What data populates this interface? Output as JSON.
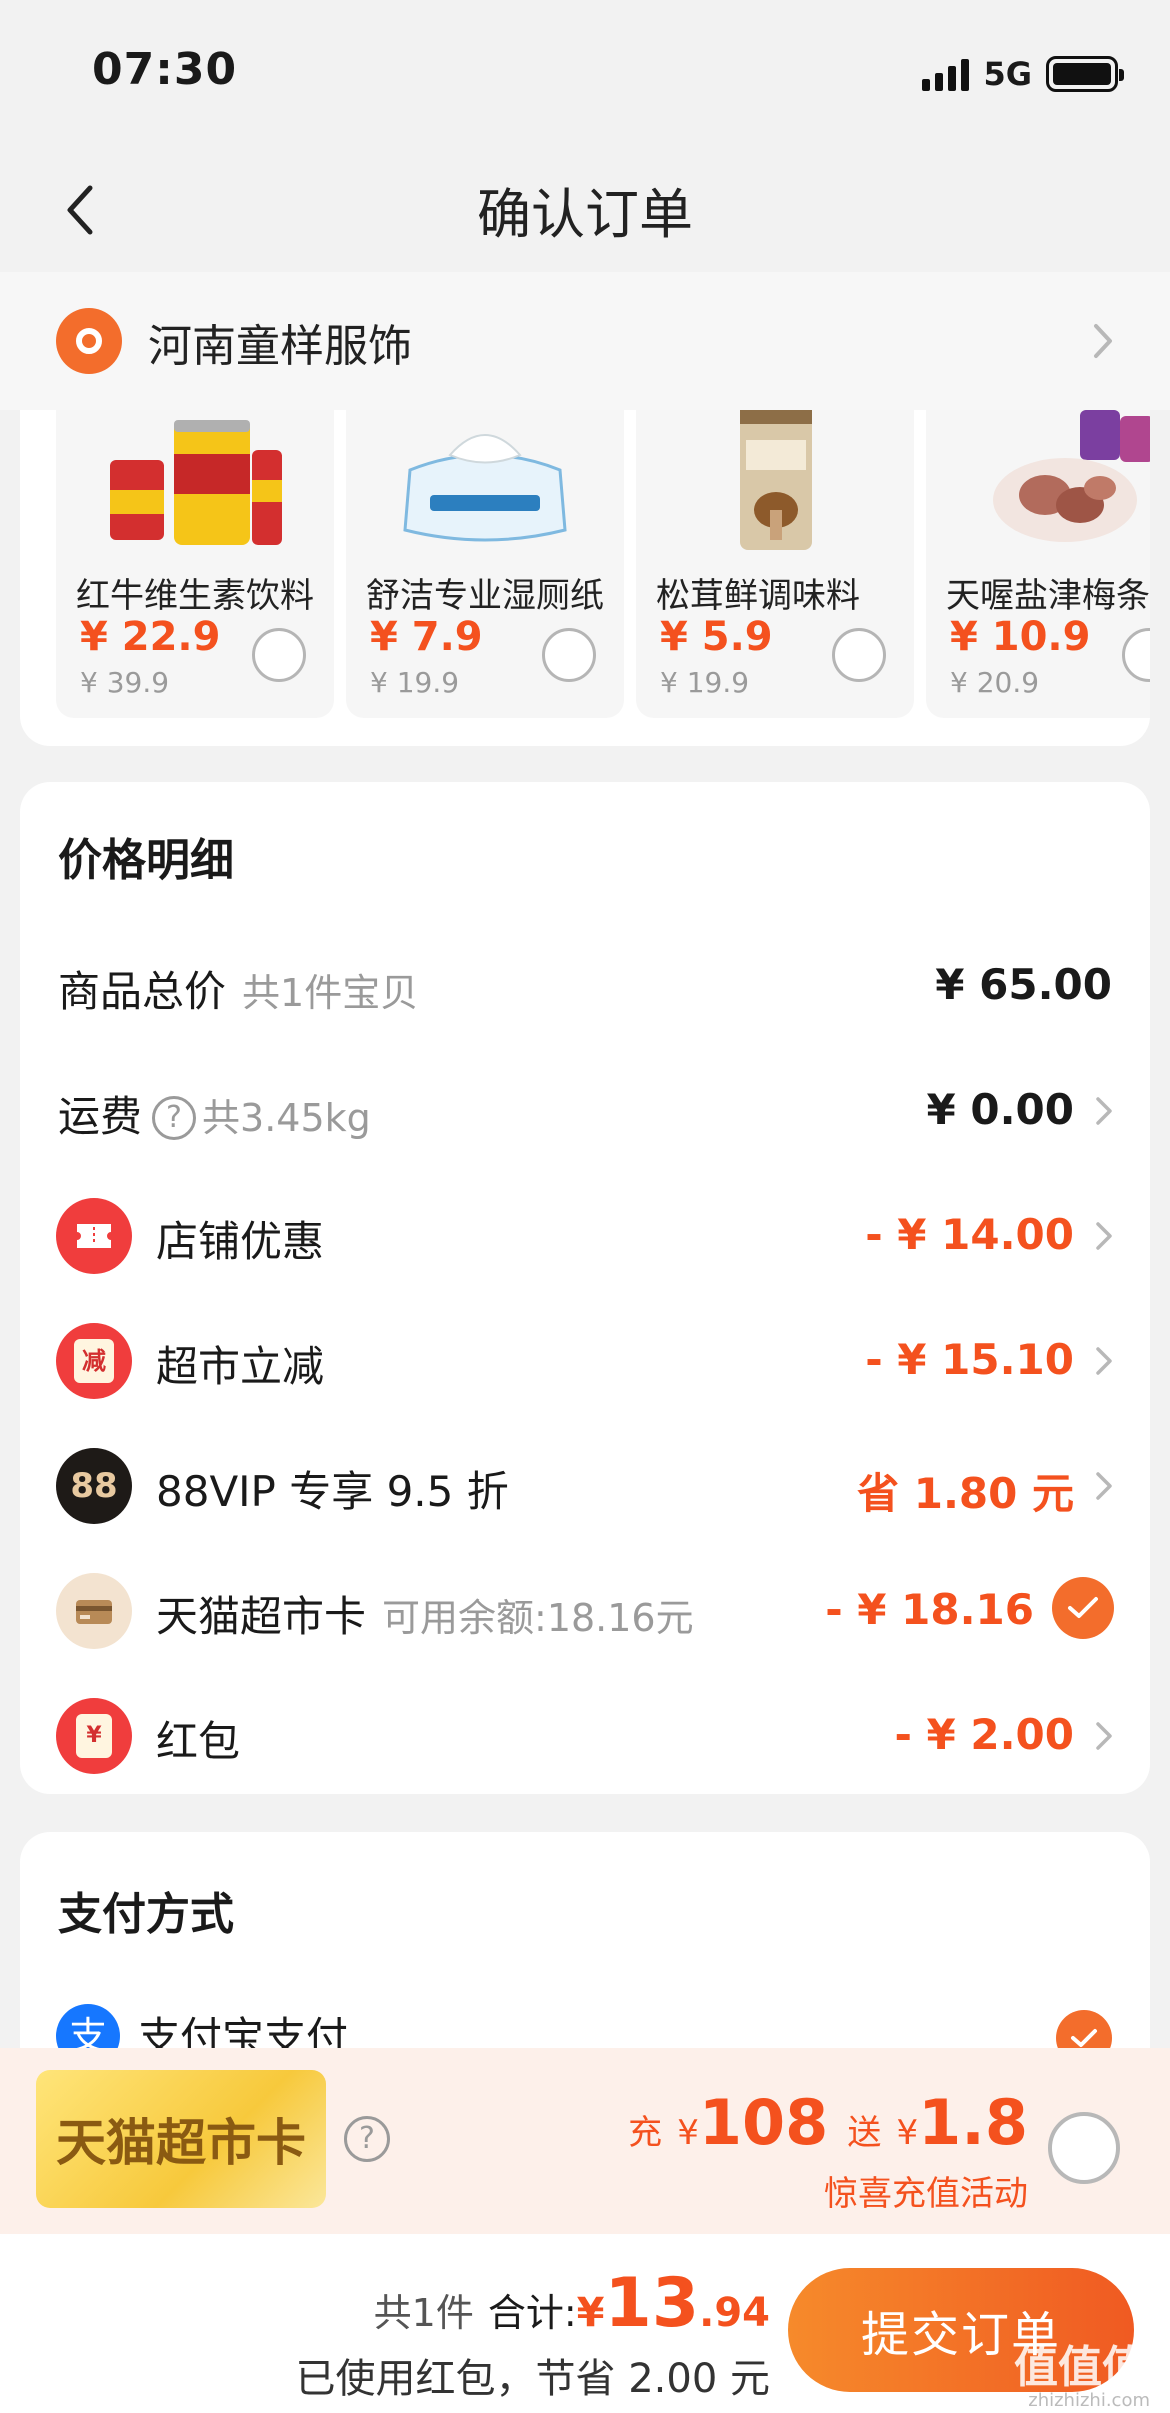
{
  "status_bar": {
    "time": "07:30",
    "network": "5G"
  },
  "nav": {
    "title": "确认订单"
  },
  "address": {
    "name": "河南童样服饰"
  },
  "products": [
    {
      "name": "红牛维生素饮料",
      "price": "¥ 22.9",
      "original_price": "¥ 39.9"
    },
    {
      "name": "舒洁专业湿厕纸",
      "price": "¥ 7.9",
      "original_price": "¥ 19.9"
    },
    {
      "name": "松茸鲜调味料",
      "price": "¥ 5.9",
      "original_price": "¥ 19.9"
    },
    {
      "name": "天喔盐津梅条",
      "price": "¥ 10.9",
      "original_price": "¥ 20.9"
    }
  ],
  "price_detail": {
    "title": "价格明细",
    "total": {
      "label": "商品总价",
      "sub": "共1件宝贝",
      "value": "¥ 65.00"
    },
    "shipping": {
      "label": "运费",
      "sub": "共3.45kg",
      "value": "¥ 0.00"
    },
    "store_discount": {
      "label": "店铺优惠",
      "value": "- ¥ 14.00"
    },
    "market_discount": {
      "label": "超市立减",
      "icon_text": "减",
      "value": "- ¥ 15.10"
    },
    "vip": {
      "label": "88VIP 专享 9.5 折",
      "icon_text": "88",
      "value": "省 1.80 元"
    },
    "card": {
      "label": "天猫超市卡",
      "sub": "可用余额:18.16元",
      "value": "- ¥ 18.16"
    },
    "redpack": {
      "label": "红包",
      "icon_text": "¥",
      "value": "- ¥ 2.00"
    }
  },
  "payment": {
    "title": "支付方式",
    "method": "支付宝支付",
    "icon_text": "支"
  },
  "promo": {
    "card_label": "天猫超市卡",
    "recharge_prefix": "充",
    "currency": "¥",
    "recharge_amount": "108",
    "gift_prefix": "送",
    "gift_amount": "1.8",
    "subtitle": "惊喜充值活动"
  },
  "bottom": {
    "count": "共1件",
    "total_label": "合计:",
    "currency": "¥",
    "total_int": "13",
    "total_dec": ".94",
    "saved": "已使用红包，节省 2.00 元",
    "submit": "提交订单",
    "watermark": "值值值",
    "watermark_site": "zhizhizhi.com"
  },
  "colors": {
    "accent": "#f4511e",
    "orange": "#f36d2c",
    "alipay": "#1677ff"
  }
}
